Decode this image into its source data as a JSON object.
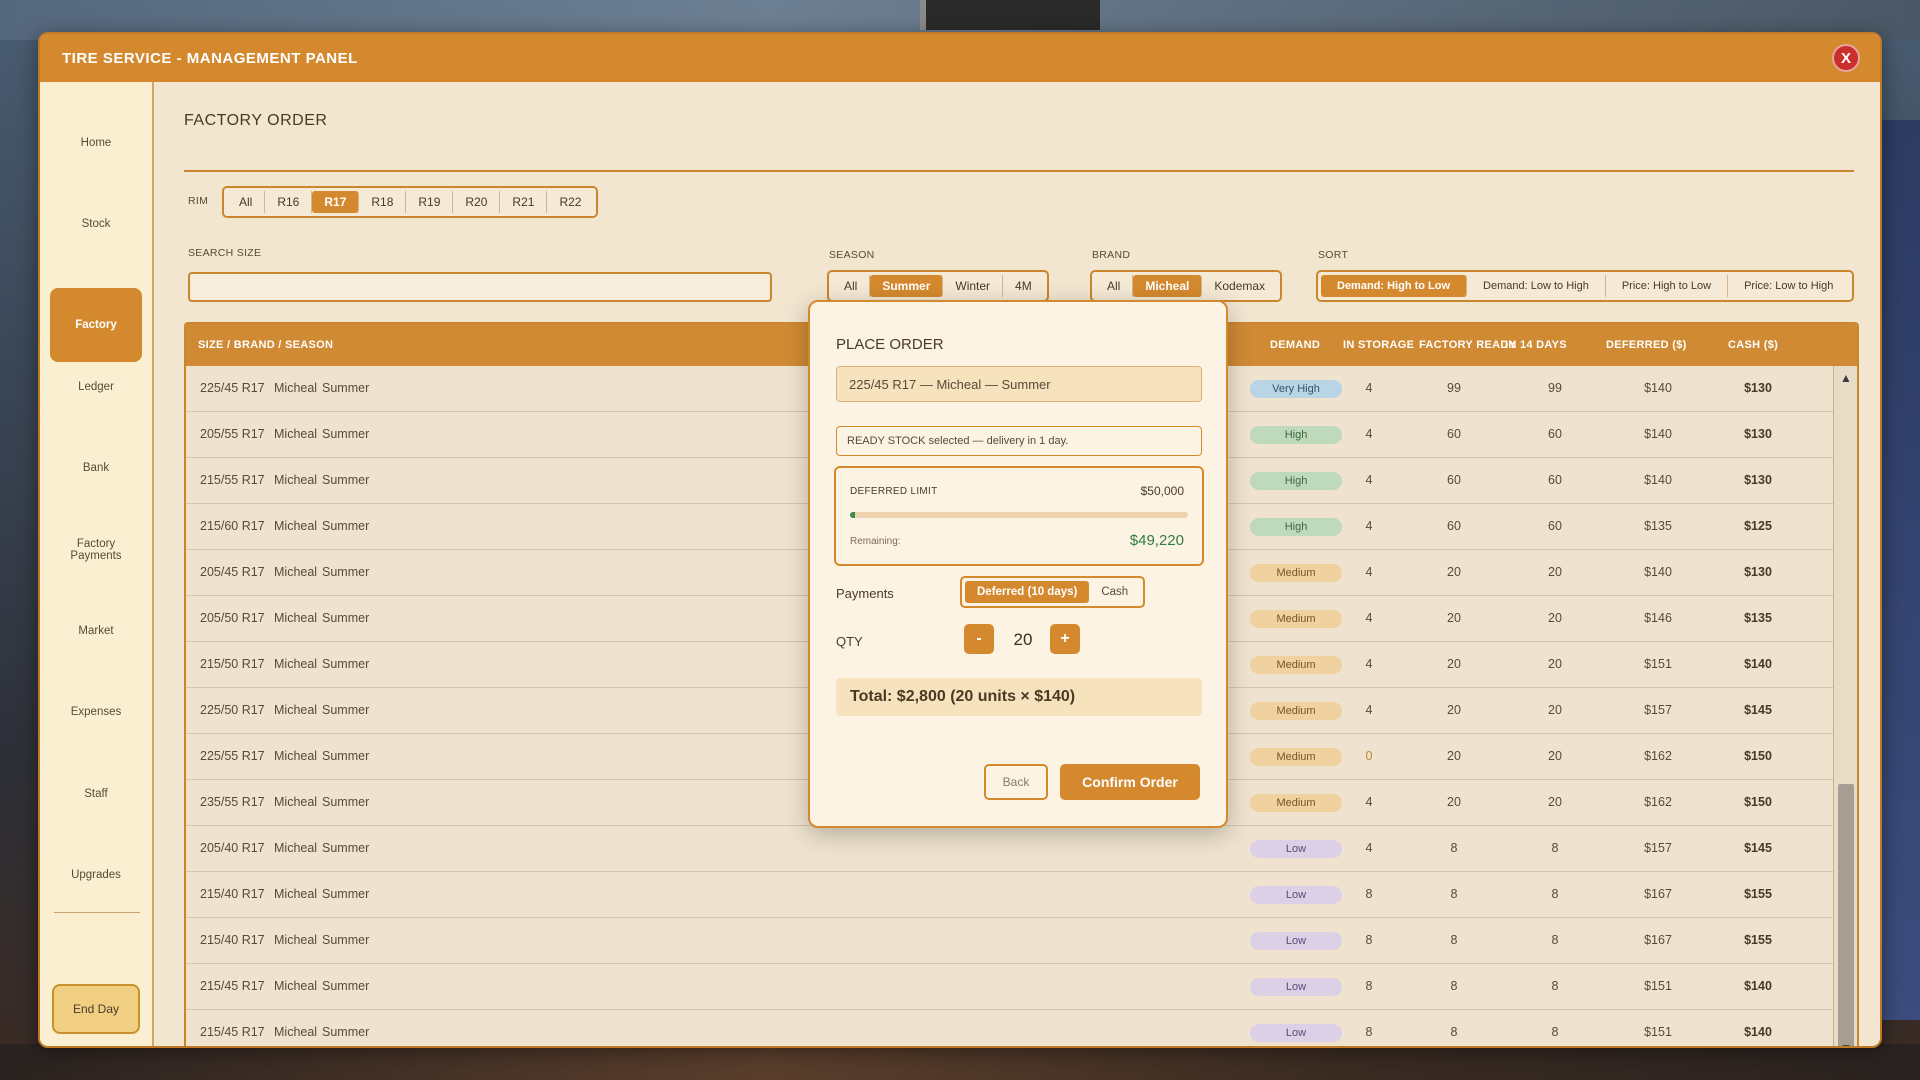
{
  "window": {
    "title": "TIRE SERVICE - MANAGEMENT PANEL",
    "close_label": "X"
  },
  "sidebar": {
    "items": [
      {
        "label": "Home",
        "active": false
      },
      {
        "label": "Stock",
        "active": false
      },
      {
        "label": "Factory",
        "active": true
      },
      {
        "label": "Ledger",
        "active": false
      },
      {
        "label": "Bank",
        "active": false
      },
      {
        "label": "Factory Payments",
        "active": false
      },
      {
        "label": "Market",
        "active": false
      },
      {
        "label": "Expenses",
        "active": false
      },
      {
        "label": "Staff",
        "active": false
      },
      {
        "label": "Upgrades",
        "active": false
      }
    ],
    "end_day": "End Day"
  },
  "main": {
    "title": "FACTORY ORDER",
    "rim": {
      "label": "RIM",
      "options": [
        "All",
        "R16",
        "R17",
        "R18",
        "R19",
        "R20",
        "R21",
        "R22"
      ],
      "selected": "R17"
    },
    "search": {
      "label": "SEARCH SIZE",
      "value": "",
      "placeholder": ""
    },
    "season": {
      "label": "SEASON",
      "options": [
        "All",
        "Summer",
        "Winter",
        "4M"
      ],
      "selected": "Summer"
    },
    "brand": {
      "label": "BRAND",
      "options": [
        "All",
        "Micheal",
        "Kodemax"
      ],
      "selected": "Micheal"
    },
    "sort": {
      "label": "SORT",
      "options": [
        "Demand: High to Low",
        "Demand: Low to High",
        "Price: High to Low",
        "Price: Low to High"
      ],
      "selected": "Demand: High to Low"
    },
    "table": {
      "headers": [
        "SIZE / BRAND / SEASON",
        "DEMAND",
        "IN STORAGE",
        "FACTORY READY",
        "IN 14 DAYS",
        "DEFERRED ($)",
        "CASH ($)"
      ],
      "rows": [
        {
          "size": "225/45 R17",
          "brand": "Micheal",
          "season": "Summer",
          "demand": "Very High",
          "storage": "4",
          "ready": "99",
          "d14": "99",
          "deferred": "$140",
          "cash": "$130"
        },
        {
          "size": "205/55 R17",
          "brand": "Micheal",
          "season": "Summer",
          "demand": "High",
          "storage": "4",
          "ready": "60",
          "d14": "60",
          "deferred": "$140",
          "cash": "$130"
        },
        {
          "size": "215/55 R17",
          "brand": "Micheal",
          "season": "Summer",
          "demand": "High",
          "storage": "4",
          "ready": "60",
          "d14": "60",
          "deferred": "$140",
          "cash": "$130"
        },
        {
          "size": "215/60 R17",
          "brand": "Micheal",
          "season": "Summer",
          "demand": "High",
          "storage": "4",
          "ready": "60",
          "d14": "60",
          "deferred": "$135",
          "cash": "$125"
        },
        {
          "size": "205/45 R17",
          "brand": "Micheal",
          "season": "Summer",
          "demand": "Medium",
          "storage": "4",
          "ready": "20",
          "d14": "20",
          "deferred": "$140",
          "cash": "$130"
        },
        {
          "size": "205/50 R17",
          "brand": "Micheal",
          "season": "Summer",
          "demand": "Medium",
          "storage": "4",
          "ready": "20",
          "d14": "20",
          "deferred": "$146",
          "cash": "$135"
        },
        {
          "size": "215/50 R17",
          "brand": "Micheal",
          "season": "Summer",
          "demand": "Medium",
          "storage": "4",
          "ready": "20",
          "d14": "20",
          "deferred": "$151",
          "cash": "$140"
        },
        {
          "size": "225/50 R17",
          "brand": "Micheal",
          "season": "Summer",
          "demand": "Medium",
          "storage": "4",
          "ready": "20",
          "d14": "20",
          "deferred": "$157",
          "cash": "$145"
        },
        {
          "size": "225/55 R17",
          "brand": "Micheal",
          "season": "Summer",
          "demand": "Medium",
          "storage": "0",
          "ready": "20",
          "d14": "20",
          "deferred": "$162",
          "cash": "$150"
        },
        {
          "size": "235/55 R17",
          "brand": "Micheal",
          "season": "Summer",
          "demand": "Medium",
          "storage": "4",
          "ready": "20",
          "d14": "20",
          "deferred": "$162",
          "cash": "$150"
        },
        {
          "size": "205/40 R17",
          "brand": "Micheal",
          "season": "Summer",
          "demand": "Low",
          "storage": "4",
          "ready": "8",
          "d14": "8",
          "deferred": "$157",
          "cash": "$145"
        },
        {
          "size": "215/40 R17",
          "brand": "Micheal",
          "season": "Summer",
          "demand": "Low",
          "storage": "8",
          "ready": "8",
          "d14": "8",
          "deferred": "$167",
          "cash": "$155"
        },
        {
          "size": "215/40 R17",
          "brand": "Micheal",
          "season": "Summer",
          "demand": "Low",
          "storage": "8",
          "ready": "8",
          "d14": "8",
          "deferred": "$167",
          "cash": "$155"
        },
        {
          "size": "215/45 R17",
          "brand": "Micheal",
          "season": "Summer",
          "demand": "Low",
          "storage": "8",
          "ready": "8",
          "d14": "8",
          "deferred": "$151",
          "cash": "$140"
        },
        {
          "size": "215/45 R17",
          "brand": "Micheal",
          "season": "Summer",
          "demand": "Low",
          "storage": "8",
          "ready": "8",
          "d14": "8",
          "deferred": "$151",
          "cash": "$140"
        }
      ]
    }
  },
  "demand_colors": {
    "Very High": {
      "bg": "#b9d4e4",
      "fg": "#2f5470"
    },
    "High": {
      "bg": "#bfd9bd",
      "fg": "#3c6a3d"
    },
    "Medium": {
      "bg": "#efd2a0",
      "fg": "#7a5420"
    },
    "Low": {
      "bg": "#dcd0e6",
      "fg": "#5d4a78"
    }
  },
  "modal": {
    "title": "PLACE ORDER",
    "product": "225/45 R17  —  Micheal  —  Summer",
    "info": "READY STOCK selected — delivery in 1 day.",
    "deferred_limit_label": "DEFERRED LIMIT",
    "deferred_limit_value": "$50,000",
    "limit_used_fraction": 0.0156,
    "remaining_label": "Remaining:",
    "remaining_value": "$49,220",
    "payments_label": "Payments",
    "payment_options": [
      "Deferred (10 days)",
      "Cash"
    ],
    "payment_selected": "Deferred (10 days)",
    "qty_label": "QTY",
    "qty_minus": "-",
    "qty_plus": "+",
    "qty_value": "20",
    "total": "Total: $2,800 (20 units × $140)",
    "back_label": "Back",
    "confirm_label": "Confirm Order"
  },
  "scroll": {
    "up": "▲",
    "down": "▼"
  }
}
